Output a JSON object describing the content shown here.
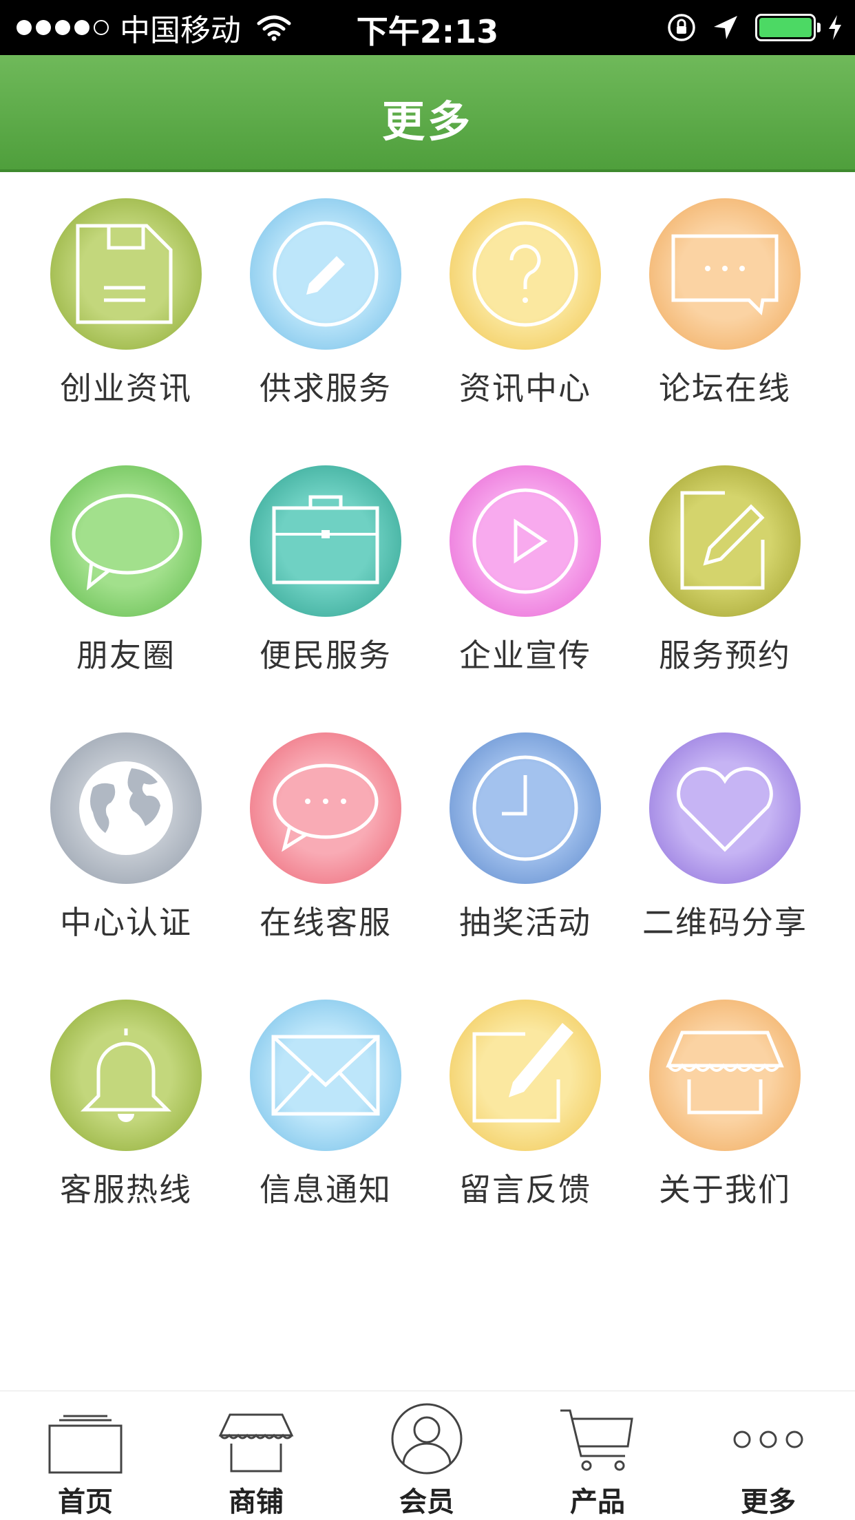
{
  "status_bar": {
    "carrier": "中国移动",
    "time": "下午2:13",
    "battery_color": "#4cd964"
  },
  "header": {
    "title": "更多"
  },
  "grid_items": [
    {
      "label": "创业资讯",
      "icon": "floppy-disk-icon",
      "color": "#b5cc6a"
    },
    {
      "label": "供求服务",
      "icon": "pencil-icon",
      "color": "#a8dcf5"
    },
    {
      "label": "资讯中心",
      "icon": "question-icon",
      "color": "#f9e08a"
    },
    {
      "label": "论坛在线",
      "icon": "chat-box-icon",
      "color": "#f9c78e"
    },
    {
      "label": "朋友圈",
      "icon": "speech-bubble-icon",
      "color": "#8fd67a"
    },
    {
      "label": "便民服务",
      "icon": "briefcase-icon",
      "color": "#5ec7b8"
    },
    {
      "label": "企业宣传",
      "icon": "play-icon",
      "color": "#f59ae8"
    },
    {
      "label": "服务预约",
      "icon": "edit-icon",
      "color": "#c8c85a"
    },
    {
      "label": "中心认证",
      "icon": "globe-icon",
      "color": "#b9c0c9"
    },
    {
      "label": "在线客服",
      "icon": "message-icon",
      "color": "#f79aa6"
    },
    {
      "label": "抽奖活动",
      "icon": "clock-icon",
      "color": "#8fb3e6"
    },
    {
      "label": "二维码分享",
      "icon": "heart-icon",
      "color": "#b9a3ef"
    },
    {
      "label": "客服热线",
      "icon": "bell-icon",
      "color": "#b5cc6a"
    },
    {
      "label": "信息通知",
      "icon": "mail-icon",
      "color": "#a8dcf5"
    },
    {
      "label": "留言反馈",
      "icon": "note-edit-icon",
      "color": "#f9e08a"
    },
    {
      "label": "关于我们",
      "icon": "store-icon",
      "color": "#f9c78e"
    }
  ],
  "tabbar": {
    "tabs": [
      {
        "label": "首页",
        "icon": "home-stack-icon"
      },
      {
        "label": "商铺",
        "icon": "shop-icon"
      },
      {
        "label": "会员",
        "icon": "user-icon"
      },
      {
        "label": "产品",
        "icon": "cart-icon"
      },
      {
        "label": "更多",
        "icon": "more-dots-icon"
      }
    ]
  }
}
